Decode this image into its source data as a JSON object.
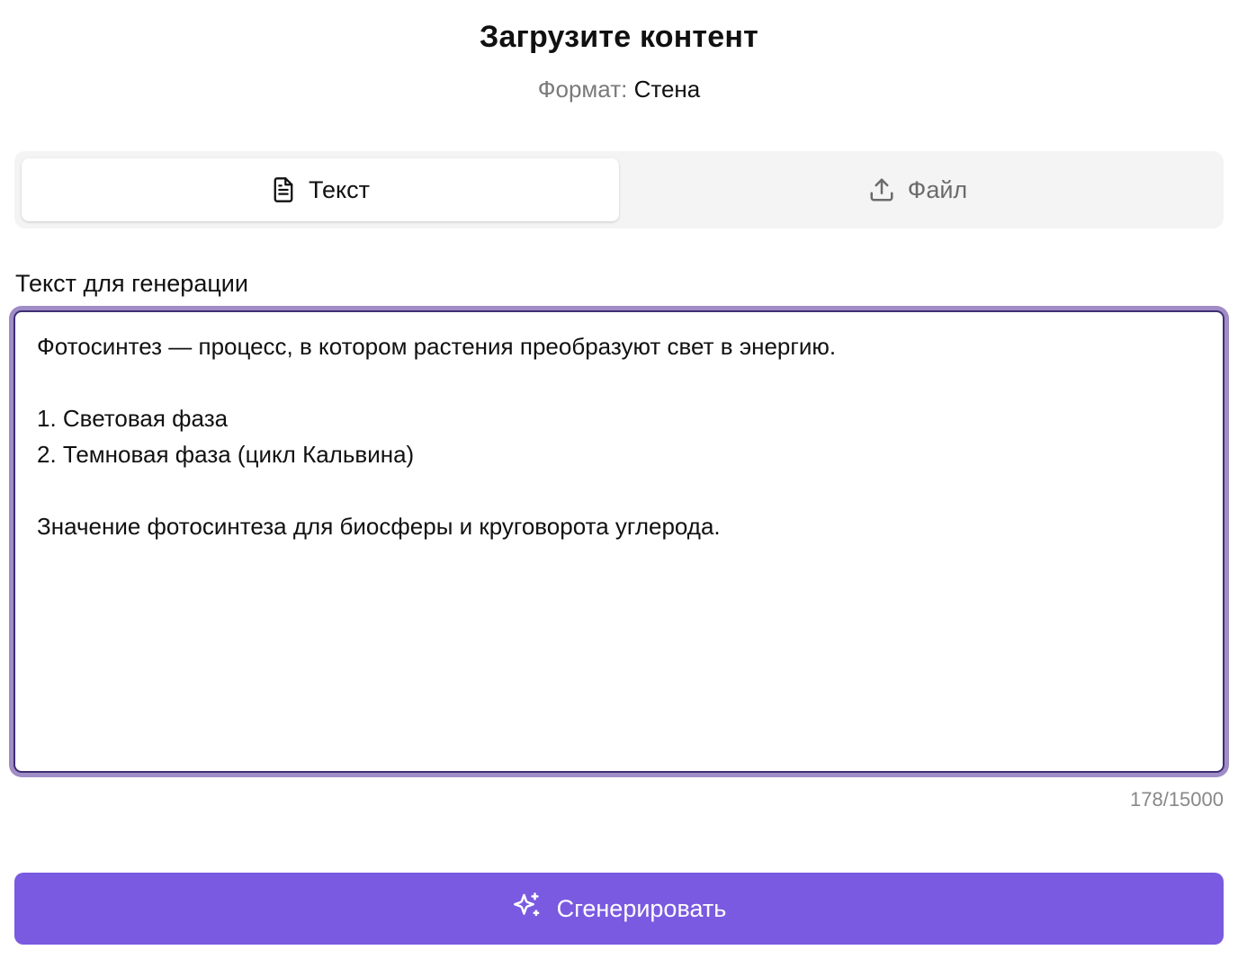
{
  "header": {
    "title": "Загрузите контент",
    "format_label": "Формат:",
    "format_value": "Стена"
  },
  "tabs": [
    {
      "label": "Текст",
      "icon": "document-icon",
      "active": true
    },
    {
      "label": "Файл",
      "icon": "upload-icon",
      "active": false
    }
  ],
  "editor": {
    "label": "Текст для генерации",
    "value": "Фотосинтез — процесс, в котором растения преобразуют свет в энергию.\n\n1. Световая фаза\n2. Темновая фаза (цикл Кальвина)\n\nЗначение фотосинтеза для биосферы и круговорота углерода.",
    "char_count": "178/15000"
  },
  "actions": {
    "generate_label": "Сгенерировать",
    "generate_icon": "sparkles-icon"
  },
  "colors": {
    "accent": "#7a5ae0",
    "focus_ring": "#a08cc6",
    "focus_border": "#3e2f74",
    "tabs_bg": "#f4f4f5"
  }
}
